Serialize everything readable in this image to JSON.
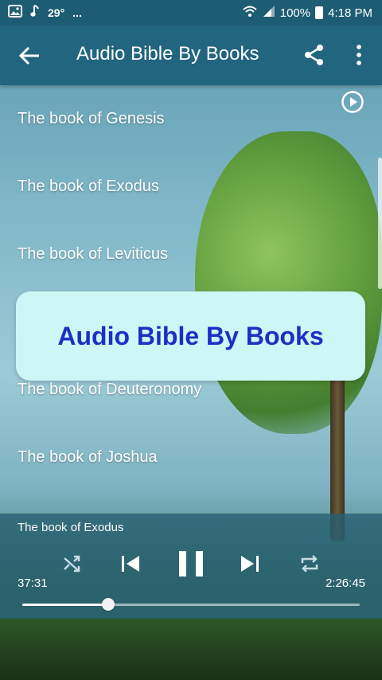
{
  "status_bar": {
    "temperature": "29°",
    "more": "...",
    "battery": "100%",
    "time": "4:18 PM"
  },
  "app_bar": {
    "title": "Audio Bible By Books"
  },
  "books": [
    {
      "label": "The book of Genesis"
    },
    {
      "label": "The book of Exodus"
    },
    {
      "label": "The book of Leviticus"
    },
    {
      "label": ""
    },
    {
      "label": "The book of Deuteronomy"
    },
    {
      "label": "The book of Joshua"
    }
  ],
  "toast": {
    "text": "Audio Bible By Books"
  },
  "player": {
    "now_playing": "The book of Exodus",
    "elapsed": "37:31",
    "total": "2:26:45",
    "progress": 0.255
  },
  "icons": {
    "back": "arrow-left",
    "share": "share",
    "more": "more-vertical",
    "play_indicator": "play-circle",
    "shuffle": "shuffle",
    "previous": "skip-previous",
    "pause": "pause",
    "next": "skip-next",
    "repeat": "repeat"
  },
  "colors": {
    "app_bar": "#22657e",
    "status_bar": "#1d5d74",
    "toast_bg": "#cdf6f6",
    "toast_text": "#1d2fc4"
  }
}
